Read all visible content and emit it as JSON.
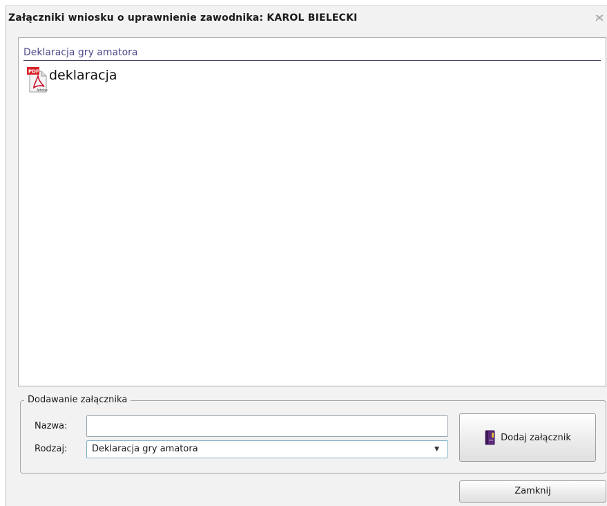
{
  "dialog": {
    "title": "Załączniki wniosku o uprawnienie zawodnika: KAROL BIELECKI",
    "close_icon": "close-icon"
  },
  "attachments": {
    "group_header": "Deklaracja gry amatora",
    "items": [
      {
        "name": "deklaracja",
        "icon": "pdf-icon"
      }
    ]
  },
  "add_section": {
    "legend": "Dodawanie załącznika",
    "name_label": "Nazwa:",
    "name_value": "",
    "type_label": "Rodzaj:",
    "type_selected": "Deklaracja gry amatora",
    "add_button_label": "Dodaj załącznik",
    "add_button_icon": "book-icon"
  },
  "footer": {
    "close_button_label": "Zamknij"
  }
}
